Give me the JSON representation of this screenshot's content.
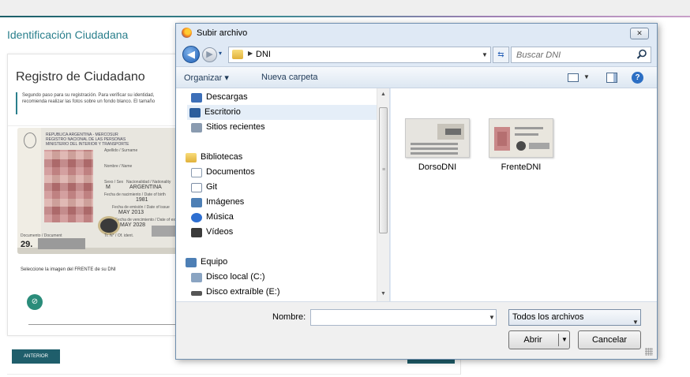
{
  "page": {
    "title": "Identificación Ciudadana",
    "card_title": "Registro de Ciudadano",
    "info_line1": "Segundo paso para su registración. Para verificar su identidad,",
    "info_line2": "recomienda realizar las fotos sobre un fondo blanco. El tamaño",
    "select_front_label": "Seleccione la imagen del FRENTE de su DNI",
    "back_button": "ANTERIOR",
    "upload_icon": "paperclip-icon",
    "accent_color": "#2a7f8c",
    "button_color": "#1f5e6b",
    "dni": {
      "header1": "REPUBLICA ARGENTINA - MERCOSUR",
      "header2": "REGISTRO NACIONAL DE LAS PERSONAS",
      "header3": "MINISTERIO DEL INTERIOR Y TRANSPORTE",
      "surname_label": "Apellido / Surname",
      "name_label": "Nombre / Name",
      "sex_label": "Sexo / Sex",
      "nationality_label": "Nacionalidad / Nationality",
      "sex_value": "M",
      "nationality_value": "ARGENTINA",
      "birth_label": "Fecha de nacimiento / Date of birth",
      "birth_value": "1981",
      "issue_label": "Fecha de emisión / Date of issue",
      "issue_value": "MAY 2013",
      "expiry_label": "Fecha de vencimiento / Date of expiry",
      "expiry_value": "MAY 2028",
      "document_label": "Documento / Document",
      "document_value": "29.",
      "tramite_label": "Tr. N° / Of. ident."
    }
  },
  "dialog": {
    "title": "Subir archivo",
    "close_label": "✕",
    "address": "DNI",
    "search_placeholder": "Buscar DNI",
    "toolbar": {
      "organize": "Organizar ▾",
      "new_folder": "Nueva carpeta"
    },
    "nav": {
      "favorites": [
        {
          "label": "Descargas",
          "icon": "download-folder-icon",
          "color": "#3d6fb8"
        },
        {
          "label": "Escritorio",
          "icon": "desktop-icon",
          "color": "#2b5d9c",
          "selected": true
        },
        {
          "label": "Sitios recientes",
          "icon": "recent-places-icon",
          "color": "#8a9bb0"
        }
      ],
      "libraries_label": "Bibliotecas",
      "libraries": [
        {
          "label": "Documentos",
          "icon": "documents-icon",
          "color": "#d9dee6"
        },
        {
          "label": "Git",
          "icon": "git-library-icon",
          "color": "#7d8ea6"
        },
        {
          "label": "Imágenes",
          "icon": "pictures-icon",
          "color": "#4d7fb5"
        },
        {
          "label": "Música",
          "icon": "music-icon",
          "color": "#2e6fd1"
        },
        {
          "label": "Vídeos",
          "icon": "videos-icon",
          "color": "#3a3a3a"
        }
      ],
      "computer_label": "Equipo",
      "drives": [
        {
          "label": "Disco local (C:)",
          "icon": "local-disk-icon",
          "color": "#8aa4c2"
        },
        {
          "label": "Disco extraíble (E:)",
          "icon": "removable-disk-icon",
          "color": "#555555"
        }
      ]
    },
    "files": [
      {
        "name": "DorsoDNI",
        "icon": "image-thumbnail-icon"
      },
      {
        "name": "FrenteDNI",
        "icon": "image-thumbnail-icon"
      }
    ],
    "filename_label": "Nombre:",
    "filename_value": "",
    "filter_value": "Todos los archivos",
    "open_label": "Abrir",
    "cancel_label": "Cancelar"
  }
}
